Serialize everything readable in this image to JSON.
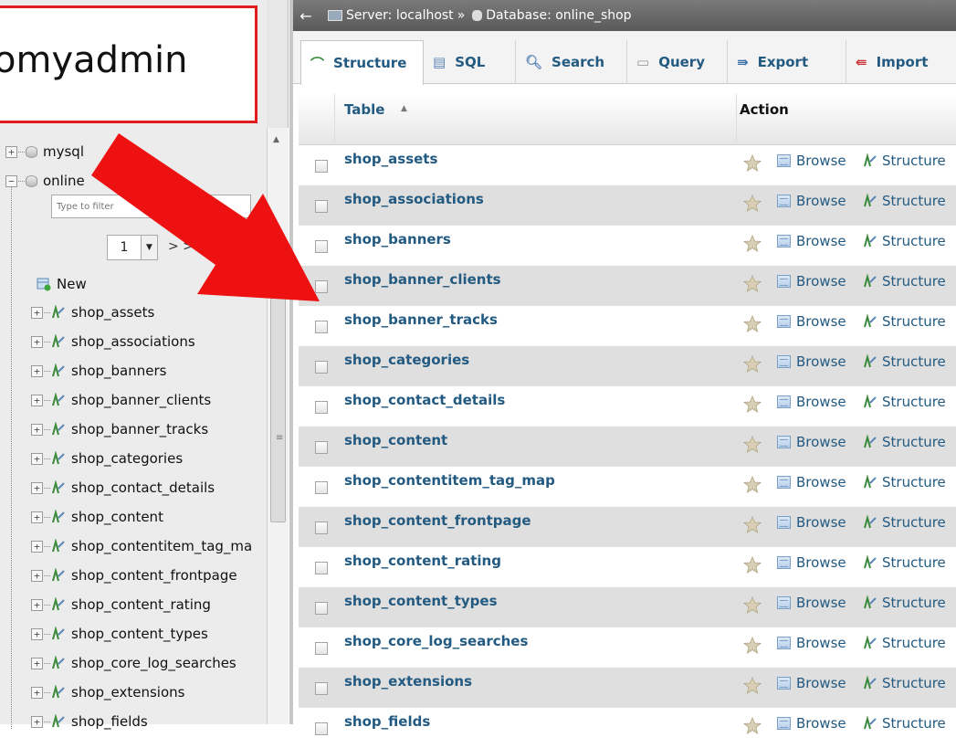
{
  "logo": {
    "text": "omyadmin"
  },
  "breadcrumb": {
    "back": "←",
    "server": "Server: localhost",
    "sep": "»",
    "database": "Database: online_shop"
  },
  "tabs": [
    {
      "label": "Structure",
      "icon": "structure-icon"
    },
    {
      "label": "SQL",
      "icon": "sql-icon"
    },
    {
      "label": "Search",
      "icon": "search-icon"
    },
    {
      "label": "Query",
      "icon": "query-icon"
    },
    {
      "label": "Export",
      "icon": "export-icon"
    },
    {
      "label": "Import",
      "icon": "import-icon"
    }
  ],
  "nav": {
    "databases": [
      {
        "label": "mysql",
        "expander": "+"
      },
      {
        "label": "online",
        "expander": "−"
      }
    ],
    "filter_placeholder": "Type to filter",
    "page": {
      "value": "1",
      "next": "> >>"
    },
    "new_label": "New",
    "tables": [
      "shop_assets",
      "shop_associations",
      "shop_banners",
      "shop_banner_clients",
      "shop_banner_tracks",
      "shop_categories",
      "shop_contact_details",
      "shop_content",
      "shop_contentitem_tag_ma",
      "shop_content_frontpage",
      "shop_content_rating",
      "shop_content_types",
      "shop_core_log_searches",
      "shop_extensions",
      "shop_fields"
    ]
  },
  "table": {
    "header_table": "Table",
    "header_sort": "▲",
    "header_action": "Action",
    "browse_label": "Browse",
    "structure_label": "Structure",
    "rows": [
      "shop_assets",
      "shop_associations",
      "shop_banners",
      "shop_banner_clients",
      "shop_banner_tracks",
      "shop_categories",
      "shop_contact_details",
      "shop_content",
      "shop_contentitem_tag_map",
      "shop_content_frontpage",
      "shop_content_rating",
      "shop_content_types",
      "shop_core_log_searches",
      "shop_extensions",
      "shop_fields"
    ]
  },
  "colors": {
    "link": "#235a81",
    "arrow": "#ee1111",
    "callout_border": "#e21c1c"
  }
}
